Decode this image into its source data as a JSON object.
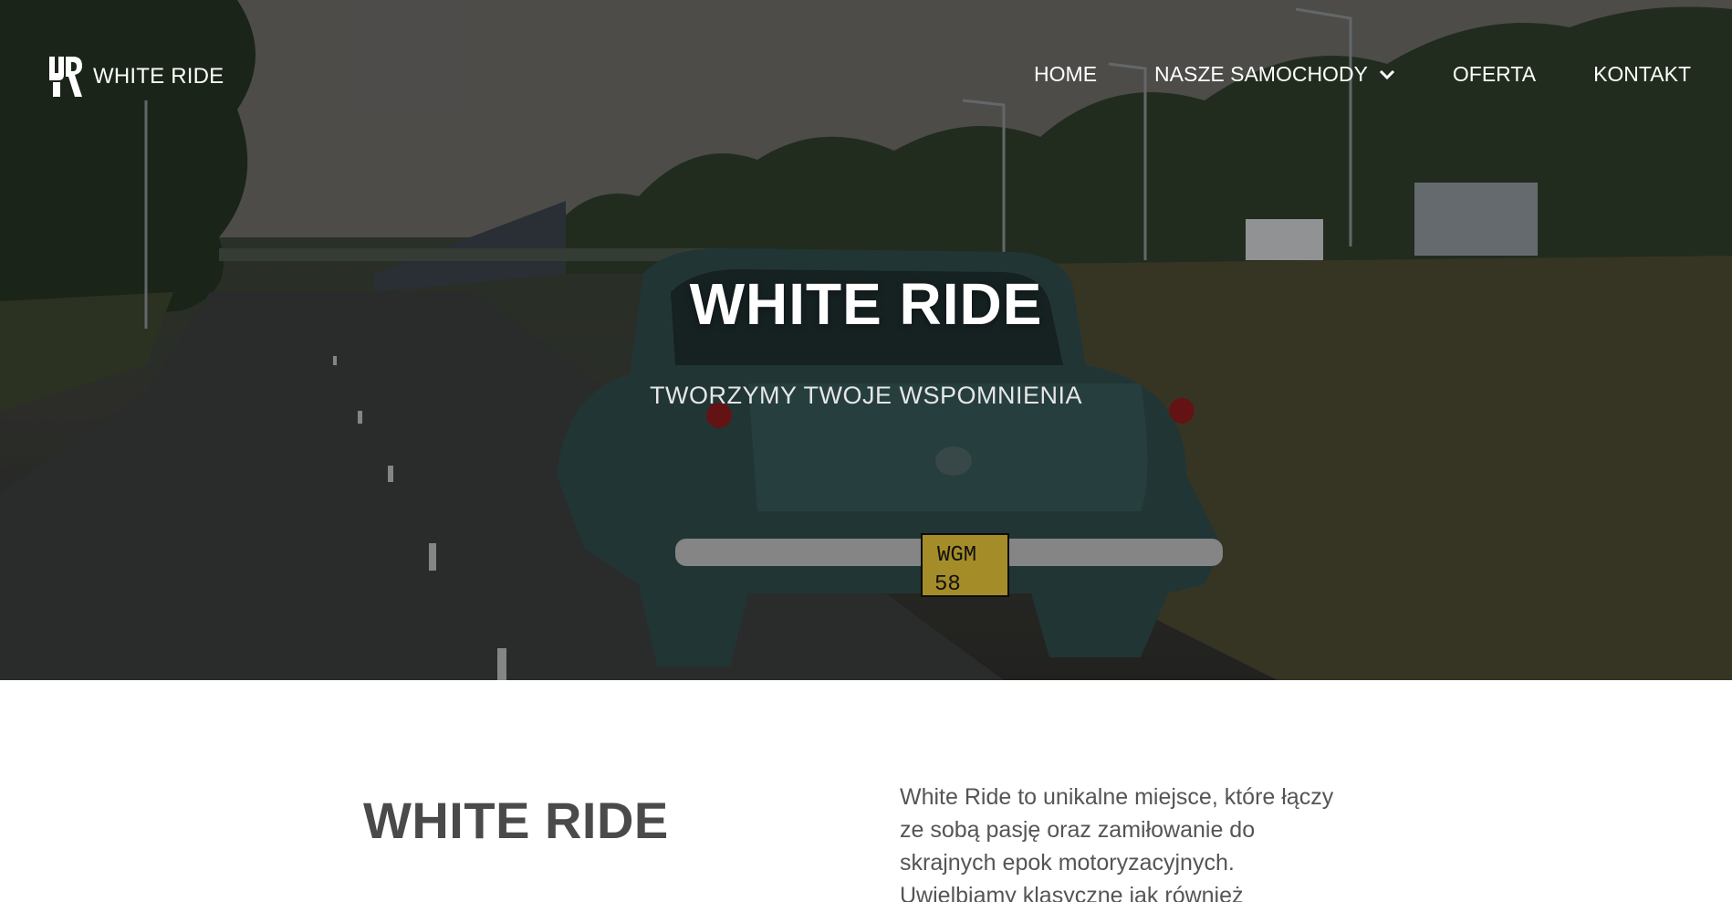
{
  "brand": {
    "name": "WHITE RIDE",
    "logo_icon": "wr-monogram-logo"
  },
  "nav": {
    "items": [
      {
        "label": "HOME"
      },
      {
        "label": "NASZE SAMOCHODY",
        "has_dropdown": true
      },
      {
        "label": "OFERTA"
      },
      {
        "label": "KONTAKT"
      }
    ]
  },
  "hero": {
    "title": "WHITE RIDE",
    "subtitle": "TWORZYMY TWOJE WSPOMNIENIA",
    "plate_line1": "WGM",
    "plate_line2": "58"
  },
  "about": {
    "title": "WHITE RIDE",
    "text": "White Ride to unikalne miejsce, które łączy ze sobą pasję oraz zamiłowanie do skrajnych epok motoryzacyjnych. Uwielbiamy klasyczne jak również"
  },
  "colors": {
    "accent": "#ffffff",
    "text_dark": "#4a4a4a",
    "car": "#2e4a4a"
  }
}
